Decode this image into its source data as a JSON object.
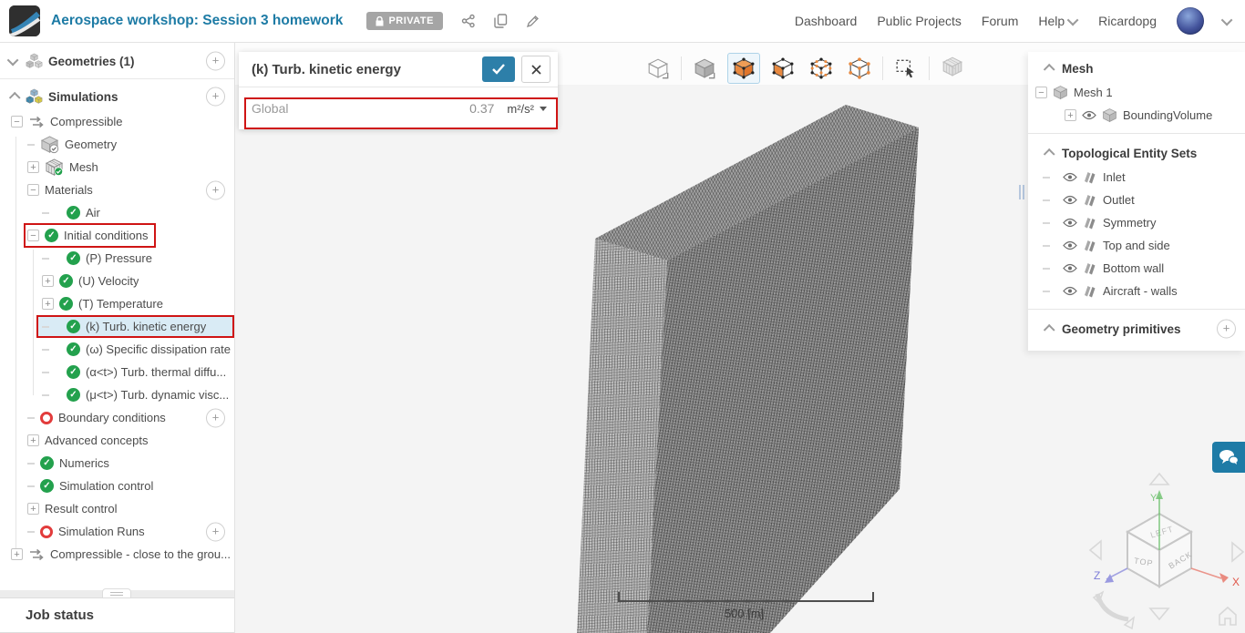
{
  "header": {
    "title": "Aerospace workshop: Session 3 homework",
    "privacy_badge": "PRIVATE",
    "nav": [
      "Dashboard",
      "Public Projects",
      "Forum",
      "Help"
    ],
    "user": "Ricardopg"
  },
  "property_panel": {
    "title": "(k) Turb. kinetic energy",
    "row": {
      "label": "Global",
      "value": "0.37",
      "unit": "m²/s²"
    }
  },
  "toolbar": {
    "tools": [
      {
        "name": "fit-view",
        "divider_after": true
      },
      {
        "name": "shaded-view"
      },
      {
        "name": "volume-selection",
        "selected": true
      },
      {
        "name": "face-selection"
      },
      {
        "name": "edge-selection"
      },
      {
        "name": "vertex-selection",
        "divider_after": true
      },
      {
        "name": "box-selection",
        "divider_after": true
      },
      {
        "name": "mesh-visibility"
      }
    ]
  },
  "left_sidebar": {
    "job_status": "Job status",
    "tree": [
      {
        "label": "Geometries (1)",
        "lvl": 0,
        "toggle": "chevron-down",
        "icon": "geometries",
        "add": true
      },
      {
        "label": "Simulations",
        "lvl": 0,
        "toggle": "chevron-up",
        "icon": "simulations",
        "add": true
      },
      {
        "label": "Compressible",
        "lvl": 1,
        "toggle": "minus",
        "icon": "flow"
      },
      {
        "label": "Geometry",
        "lvl": 2,
        "toggle": "dash",
        "icon": "geometry-check"
      },
      {
        "label": "Mesh",
        "lvl": 2,
        "toggle": "plus",
        "icon": "mesh-check"
      },
      {
        "label": "Materials",
        "lvl": 2,
        "toggle": "minus",
        "add": true
      },
      {
        "label": "Air",
        "lvl": 3,
        "toggle": "dash",
        "status": "check"
      },
      {
        "label": "Initial conditions",
        "lvl": 2,
        "toggle": "minus",
        "status": "check",
        "ann": "content"
      },
      {
        "label": "(P) Pressure",
        "lvl": 3,
        "toggle": "dash",
        "status": "check"
      },
      {
        "label": "(U) Velocity",
        "lvl": 3,
        "toggle": "plus",
        "status": "check"
      },
      {
        "label": "(T) Temperature",
        "lvl": 3,
        "toggle": "plus",
        "status": "check"
      },
      {
        "label": "(k) Turb. kinetic energy",
        "lvl": 3,
        "toggle": "dash",
        "status": "check",
        "selected": true,
        "ann": "row"
      },
      {
        "label": "(ω) Specific dissipation rate",
        "lvl": 3,
        "toggle": "dash",
        "status": "check"
      },
      {
        "label": "(α<t>) Turb. thermal diffu...",
        "lvl": 3,
        "toggle": "dash",
        "status": "check"
      },
      {
        "label": "(μ<t>) Turb. dynamic visc...",
        "lvl": 3,
        "toggle": "dash",
        "status": "check"
      },
      {
        "label": "Boundary conditions",
        "lvl": 2,
        "toggle": "dash",
        "status": "error",
        "add": true
      },
      {
        "label": "Advanced concepts",
        "lvl": 2,
        "toggle": "plus"
      },
      {
        "label": "Numerics",
        "lvl": 2,
        "toggle": "dash",
        "status": "check"
      },
      {
        "label": "Simulation control",
        "lvl": 2,
        "toggle": "dash",
        "status": "check"
      },
      {
        "label": "Result control",
        "lvl": 2,
        "toggle": "plus"
      },
      {
        "label": "Simulation Runs",
        "lvl": 2,
        "toggle": "dash",
        "status": "error",
        "add": true
      },
      {
        "label": "Compressible - close to the grou...",
        "lvl": 1,
        "toggle": "plus",
        "icon": "flow"
      }
    ]
  },
  "right_panel": {
    "sections": [
      {
        "title": "Mesh",
        "items": [
          {
            "label": "Mesh 1",
            "lvl": 1,
            "toggle": "minus",
            "icon": "cube-gray"
          },
          {
            "label": "BoundingVolume",
            "lvl": 2,
            "toggle": "plus",
            "eye": true,
            "icon": "cube-gray"
          }
        ]
      },
      {
        "title": "Topological Entity Sets",
        "items": [
          {
            "label": "Inlet",
            "lvl": 3,
            "toggle": "dash",
            "eye": true,
            "icon": "layers"
          },
          {
            "label": "Outlet",
            "lvl": 3,
            "toggle": "dash",
            "eye": true,
            "icon": "layers"
          },
          {
            "label": "Symmetry",
            "lvl": 3,
            "toggle": "dash",
            "eye": true,
            "icon": "layers"
          },
          {
            "label": "Top and side",
            "lvl": 3,
            "toggle": "dash",
            "eye": true,
            "icon": "layers"
          },
          {
            "label": "Bottom wall",
            "lvl": 3,
            "toggle": "dash",
            "eye": true,
            "icon": "layers"
          },
          {
            "label": "Aircraft - walls",
            "lvl": 3,
            "toggle": "dash",
            "eye": true,
            "icon": "layers"
          }
        ]
      },
      {
        "title": "Geometry primitives",
        "add": true,
        "items": []
      }
    ]
  },
  "viewport": {
    "scale_label": "500 [m]",
    "nav_cube": {
      "top_face": "LEFT",
      "left_face": "TOP",
      "right_face": "BACK",
      "axis_x": "X",
      "axis_y": "Y",
      "axis_z": "Z"
    }
  },
  "colors": {
    "accent": "#1e7ba6",
    "selection": "#d9ebf5",
    "annotation": "#cf1414",
    "success": "#23a14d",
    "error": "#e23c3c"
  }
}
